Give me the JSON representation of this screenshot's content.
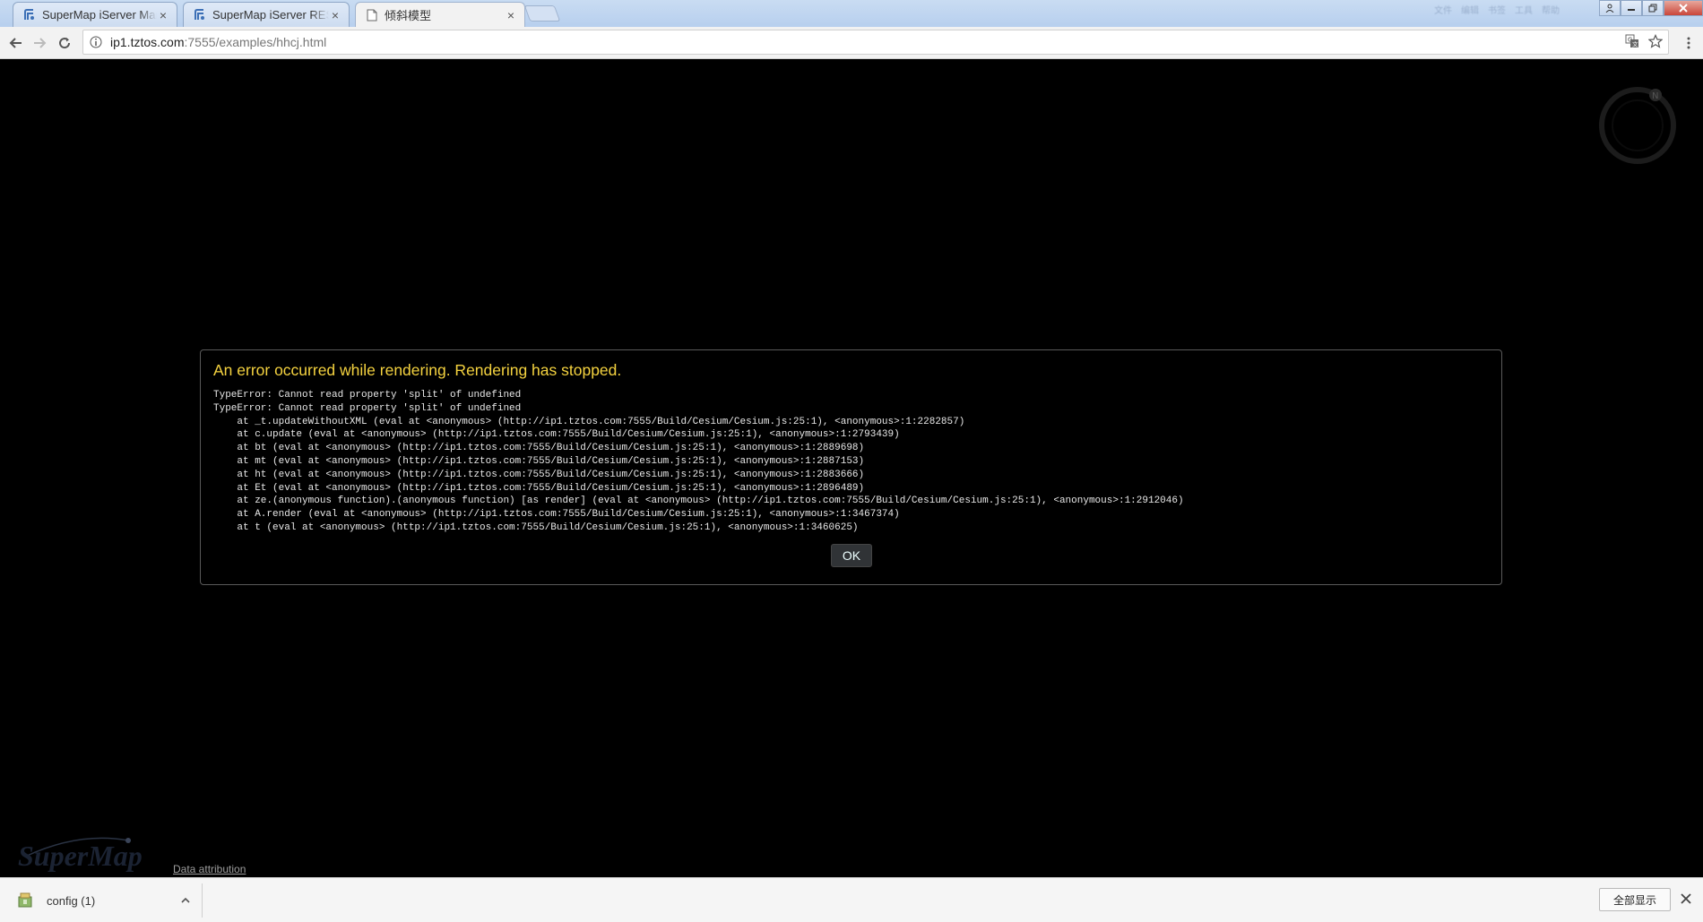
{
  "browser": {
    "tabs": [
      {
        "title": "SuperMap iServer Man",
        "favicon": "supermap-icon",
        "active": false
      },
      {
        "title": "SuperMap iServer REST",
        "favicon": "supermap-icon",
        "active": false
      },
      {
        "title": "倾斜模型",
        "favicon": "page-icon",
        "active": true
      }
    ],
    "tab_close_glyph": "×",
    "blurred_titlebar_items": [
      "文件",
      "编辑",
      "书签",
      "工具",
      "帮助"
    ],
    "address": {
      "host": "ip1.tztos.com",
      "rest": ":7555/examples/hhcj.html"
    }
  },
  "error_dialog": {
    "title": "An error occurred while rendering. Rendering has stopped.",
    "message": "TypeError: Cannot read property 'split' of undefined\nTypeError: Cannot read property 'split' of undefined\n    at _t.updateWithoutXML (eval at <anonymous> (http://ip1.tztos.com:7555/Build/Cesium/Cesium.js:25:1), <anonymous>:1:2282857)\n    at c.update (eval at <anonymous> (http://ip1.tztos.com:7555/Build/Cesium/Cesium.js:25:1), <anonymous>:1:2793439)\n    at bt (eval at <anonymous> (http://ip1.tztos.com:7555/Build/Cesium/Cesium.js:25:1), <anonymous>:1:2889698)\n    at mt (eval at <anonymous> (http://ip1.tztos.com:7555/Build/Cesium/Cesium.js:25:1), <anonymous>:1:2887153)\n    at ht (eval at <anonymous> (http://ip1.tztos.com:7555/Build/Cesium/Cesium.js:25:1), <anonymous>:1:2883666)\n    at Et (eval at <anonymous> (http://ip1.tztos.com:7555/Build/Cesium/Cesium.js:25:1), <anonymous>:1:2896489)\n    at ze.(anonymous function).(anonymous function) [as render] (eval at <anonymous> (http://ip1.tztos.com:7555/Build/Cesium/Cesium.js:25:1), <anonymous>:1:2912046)\n    at A.render (eval at <anonymous> (http://ip1.tztos.com:7555/Build/Cesium/Cesium.js:25:1), <anonymous>:1:3467374)\n    at t (eval at <anonymous> (http://ip1.tztos.com:7555/Build/Cesium/Cesium.js:25:1), <anonymous>:1:3460625)",
    "ok_label": "OK"
  },
  "viewer": {
    "compass_label": "N",
    "logo_text": "SuperMap",
    "attribution": "Data attribution"
  },
  "download_shelf": {
    "item_name": "config (1)",
    "item_icon": "file-archive-icon",
    "show_all_label": "全部显示",
    "close_glyph": "✕"
  },
  "colors": {
    "error_title": "#f4d23f",
    "viewport_bg": "#000000",
    "ok_button_bg": "#303336"
  }
}
